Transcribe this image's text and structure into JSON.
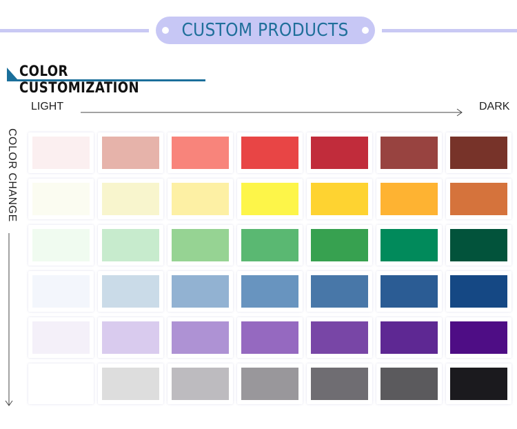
{
  "banner": {
    "title": "CUSTOM PRODUCTS",
    "pill_color": "#c7c7f5",
    "text_color": "#1f6f9a"
  },
  "section": {
    "title": "COLOR CUSTOMIZATION",
    "accent_color": "#1a6f9b"
  },
  "axes": {
    "horizontal_start_label": "LIGHT",
    "horizontal_end_label": "DARK",
    "vertical_label": "COLOR CHANGE",
    "horizontal_arrow_icon": "arrow-right-icon",
    "vertical_arrow_icon": "arrow-down-icon"
  },
  "palette": {
    "rows": [
      {
        "family": "red",
        "colors": [
          "#fbeff0",
          "#e6b3aa",
          "#f8847b",
          "#e84545",
          "#c12c3b",
          "#984340",
          "#773329"
        ]
      },
      {
        "family": "yellow",
        "colors": [
          "#fbfcf1",
          "#f8f5cd",
          "#fdf0a4",
          "#fdf549",
          "#fed331",
          "#feb332",
          "#d5733c"
        ]
      },
      {
        "family": "green",
        "colors": [
          "#f0fbf0",
          "#c7ebcd",
          "#96d393",
          "#5ab872",
          "#37a150",
          "#018a5b",
          "#02533b"
        ]
      },
      {
        "family": "blue",
        "colors": [
          "#f3f6fc",
          "#cadbe8",
          "#92b2d2",
          "#6894bf",
          "#4877a8",
          "#2b5c94",
          "#154884"
        ]
      },
      {
        "family": "purple",
        "colors": [
          "#f4f0f9",
          "#d9cbee",
          "#ae92d4",
          "#9569c0",
          "#7846a6",
          "#5e2893",
          "#4e0d85"
        ]
      },
      {
        "family": "gray",
        "colors": [
          "#ffffff",
          "#dddddd",
          "#bdbbbf",
          "#99979b",
          "#6f6d72",
          "#5b5a5d",
          "#1b1a1e"
        ]
      }
    ]
  }
}
